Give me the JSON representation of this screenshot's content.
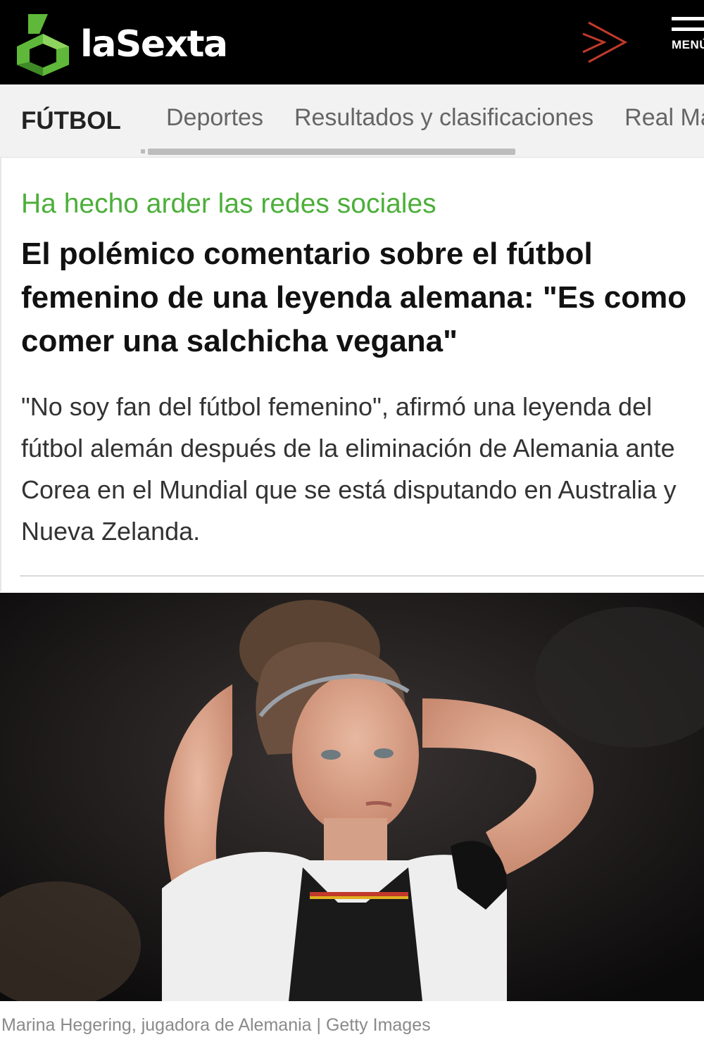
{
  "header": {
    "logo_text": "laSexta",
    "menu_label": "MENÚ",
    "brand_green": "#5fb83a",
    "icons": [
      "lasexta-logo-icon",
      "play-arrow-icon",
      "hamburger-menu-icon"
    ]
  },
  "subnav": {
    "section": "FÚTBOL",
    "links": [
      "Deportes",
      "Resultados y clasificaciones",
      "Real Madrid"
    ]
  },
  "article": {
    "kicker": "Ha hecho arder las redes sociales",
    "kicker_color": "#4caf3a",
    "headline": "El polémico comentario sobre el fútbol femenino de una leyenda alemana: \"Es como comer una salchicha vegana\"",
    "lead": "\"No soy fan del fútbol femenino\", afirmó una leyenda del fútbol alemán después de la eliminación de Alemania ante Corea en el Mundial que se está disputando en Australia y Nueva Zelanda.",
    "caption": "Marina Hegering, jugadora de Alemania | Getty Images"
  }
}
